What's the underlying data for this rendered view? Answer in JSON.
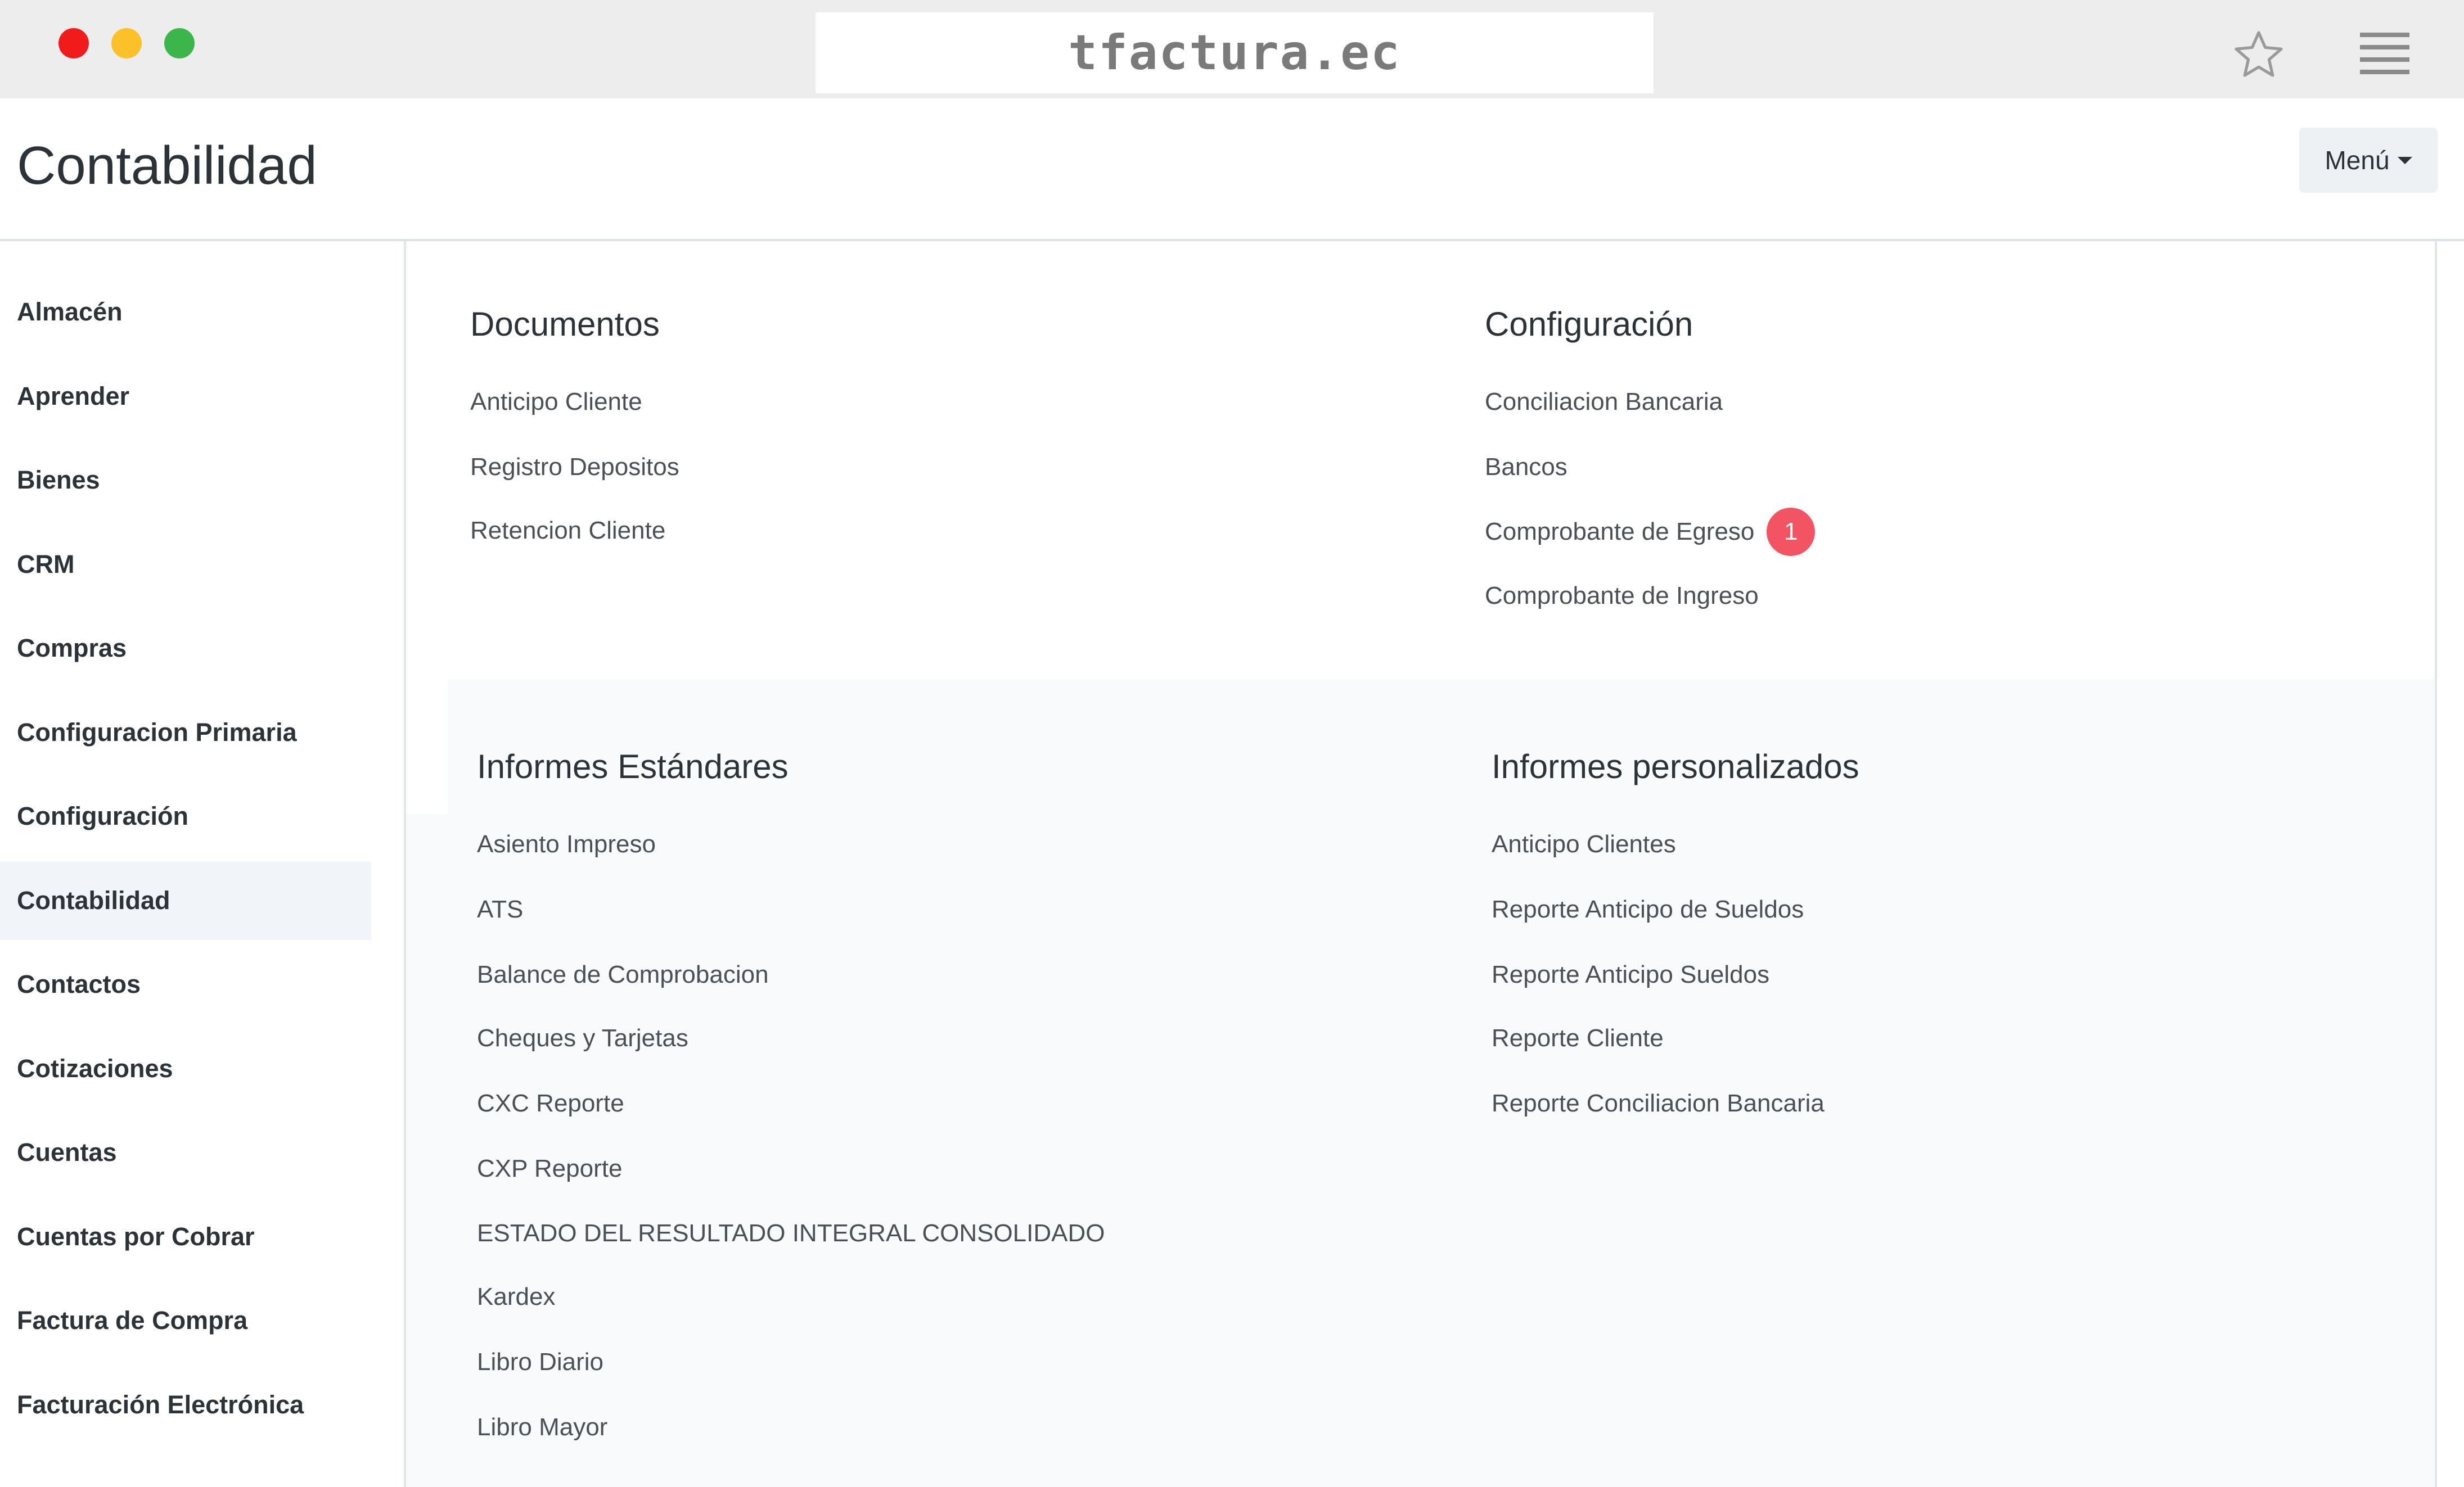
{
  "browser": {
    "url": "tfactura.ec",
    "colors": {
      "close": "#f21b1b",
      "minimize": "#fcc128",
      "maximize": "#3cb54a"
    },
    "icons": [
      "star-icon",
      "hamburger-menu-icon"
    ]
  },
  "header": {
    "title": "Contabilidad",
    "menu_label": "Menú"
  },
  "sidebar": {
    "items": [
      {
        "label": "Almacén"
      },
      {
        "label": "Aprender"
      },
      {
        "label": "Bienes"
      },
      {
        "label": "CRM"
      },
      {
        "label": "Compras"
      },
      {
        "label": "Configuracion Primaria"
      },
      {
        "label": "Configuración"
      },
      {
        "label": "Contabilidad",
        "active": true
      },
      {
        "label": "Contactos"
      },
      {
        "label": "Cotizaciones"
      },
      {
        "label": "Cuentas"
      },
      {
        "label": "Cuentas por Cobrar"
      },
      {
        "label": "Factura de Compra"
      },
      {
        "label": "Facturación Electrónica"
      }
    ]
  },
  "sections": {
    "documentos": {
      "title": "Documentos",
      "links": [
        "Anticipo Cliente",
        "Registro Depositos",
        "Retencion Cliente"
      ]
    },
    "configuracion": {
      "title": "Configuración",
      "links": [
        "Conciliacion Bancaria",
        "Bancos",
        "Comprobante de Egreso",
        "Comprobante de Ingreso"
      ],
      "badge": "1",
      "badge_color": "#f25463"
    },
    "informes_estandares": {
      "title": "Informes Estándares",
      "links": [
        "Asiento Impreso",
        "ATS",
        "Balance de Comprobacion",
        "Cheques y Tarjetas",
        "CXC Reporte",
        "CXP Reporte",
        "ESTADO DEL RESULTADO INTEGRAL CONSOLIDADO",
        "Kardex",
        "Libro Diario",
        "Libro Mayor"
      ]
    },
    "informes_personalizados": {
      "title": "Informes personalizados",
      "links": [
        "Anticipo Clientes",
        "Reporte Anticipo de Sueldos",
        "Reporte Anticipo Sueldos",
        "Reporte Cliente",
        "Reporte Conciliacion Bancaria"
      ]
    }
  }
}
